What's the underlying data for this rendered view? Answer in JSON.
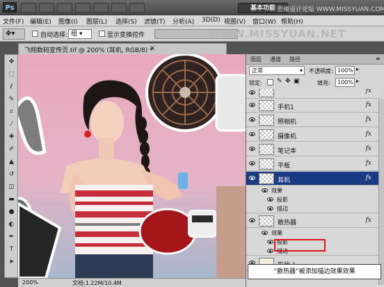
{
  "titlebar": {
    "logo": "Ps",
    "workspace": "基本功能",
    "watermark": "思缘设计论坛 WWW.MISSYUAN.COM"
  },
  "menu": [
    "文件(F)",
    "编辑(E)",
    "图像(I)",
    "图层(L)",
    "选择(S)",
    "滤镜(T)",
    "分析(A)",
    "3D(D)",
    "视图(V)",
    "窗口(W)",
    "帮助(H)"
  ],
  "options": {
    "auto_select": "自动选择:",
    "auto_select_value": "组",
    "show_transform": "显示变换控件",
    "watermark": "WWW.MISSYUAN.NET"
  },
  "document": {
    "tab": "飞翔数码宣传页.tif @ 200% (耳机, RGB/8) *",
    "close": "×",
    "zoom": "200%",
    "doc_size": "文档:1.22M/10.4M"
  },
  "layers_panel": {
    "tabs": [
      "图层",
      "通道",
      "路径"
    ],
    "blend_mode": "正常",
    "opacity_label": "不透明度:",
    "opacity": "100%",
    "lock_label": "锁定:",
    "fill_label": "填充:",
    "fill": "100%",
    "layers": [
      {
        "name": "",
        "fx": "fx",
        "selected": false
      },
      {
        "name": "手机1",
        "fx": "fx",
        "selected": false
      },
      {
        "name": "照相机",
        "fx": "fx",
        "selected": false
      },
      {
        "name": "摄像机",
        "fx": "fx",
        "selected": false
      },
      {
        "name": "笔记本",
        "fx": "fx",
        "selected": false
      },
      {
        "name": "平板",
        "fx": "fx",
        "selected": false
      },
      {
        "name": "耳机",
        "fx": "fx",
        "selected": true
      }
    ],
    "headphone_effects": {
      "label": "效果",
      "items": [
        "投影",
        "描边"
      ]
    },
    "fan_layer": {
      "name": "散热器",
      "fx": "fx"
    },
    "fan_effects": {
      "label": "效果",
      "items": [
        "投影",
        "描边"
      ]
    },
    "shape_layer": {
      "name": "形状 1"
    }
  },
  "caption": "“散热器”被添加描边效果效果",
  "colors": {
    "selected_layer": "#1b3a84",
    "highlight": "#e01010"
  }
}
